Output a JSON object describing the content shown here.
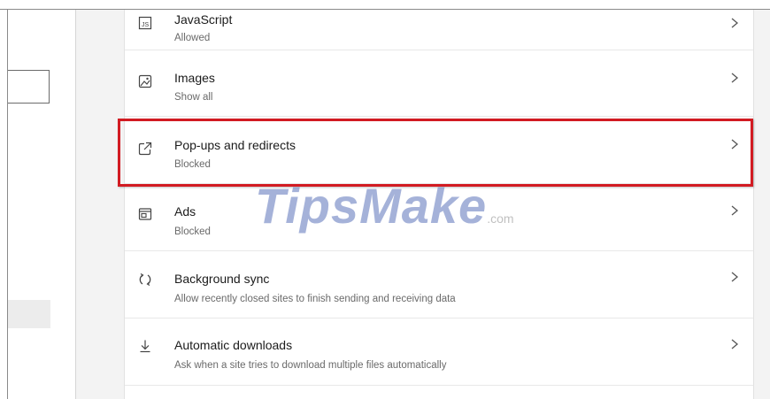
{
  "settings": {
    "items": [
      {
        "key": "javascript",
        "title": "JavaScript",
        "subtitle": "Allowed",
        "icon": "javascript-icon"
      },
      {
        "key": "images",
        "title": "Images",
        "subtitle": "Show all",
        "icon": "image-icon"
      },
      {
        "key": "popups",
        "title": "Pop-ups and redirects",
        "subtitle": "Blocked",
        "icon": "popup-icon"
      },
      {
        "key": "ads",
        "title": "Ads",
        "subtitle": "Blocked",
        "icon": "ads-icon"
      },
      {
        "key": "background_sync",
        "title": "Background sync",
        "subtitle": "Allow recently closed sites to finish sending and receiving data",
        "icon": "sync-icon"
      },
      {
        "key": "automatic_downloads",
        "title": "Automatic downloads",
        "subtitle": "Ask when a site tries to download multiple files automatically",
        "icon": "download-icon"
      }
    ]
  },
  "watermark": {
    "text": "TipsMake",
    "suffix": ".com"
  },
  "colors": {
    "highlight": "#d21b22",
    "panel": "#f3f3f3"
  }
}
